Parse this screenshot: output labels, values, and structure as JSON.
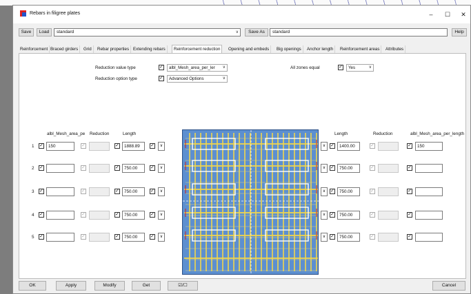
{
  "window": {
    "title": "Rebars in filigree plates",
    "minimize": "–",
    "maximize": "☐",
    "close": "✕"
  },
  "toolbar": {
    "save_label": "Save",
    "load_label": "Load",
    "preset_value": "standard",
    "saveas_label": "Save As",
    "saveas_value": "standard",
    "help_label": "Help"
  },
  "tabs": [
    "Reinforcement",
    "Braced girders",
    "Grid",
    "Rebar properties",
    "Extending rebars",
    "Reinforcement reduction",
    "Opening and embeds",
    "Big openings",
    "Anchor length",
    "Reinforcement areas",
    "Attributes"
  ],
  "active_tab": 5,
  "reduction": {
    "value_type_label": "Reduction value type",
    "value_type": "albl_Mesh_area_per_ler",
    "option_type_label": "Reduction option type",
    "option_type": "Advanced Options",
    "all_zones_label": "All zones equal",
    "all_zones_value": "Yes"
  },
  "left_headers": {
    "mesh": "albl_Mesh_area_pe",
    "reduction": "Reduction",
    "length": "Length"
  },
  "right_headers": {
    "length": "Length",
    "reduction": "Reduction",
    "mesh": "albl_Mesh_area_per_length"
  },
  "rows": [
    {
      "n": "1",
      "left_mesh": "150",
      "left_length": "1888.89",
      "right_length": "1400.00",
      "right_mesh": "150"
    },
    {
      "n": "2",
      "left_mesh": "",
      "left_length": "750.00",
      "right_length": "750.00",
      "right_mesh": ""
    },
    {
      "n": "3",
      "left_mesh": "",
      "left_length": "750.00",
      "right_length": "750.00",
      "right_mesh": ""
    },
    {
      "n": "4",
      "left_mesh": "",
      "left_length": "750.00",
      "right_length": "750.00",
      "right_mesh": ""
    },
    {
      "n": "5",
      "left_mesh": "",
      "left_length": "750.00",
      "right_length": "750.00",
      "right_mesh": ""
    }
  ],
  "bottom": {
    "ok": "OK",
    "apply": "Apply",
    "modify": "Modify",
    "get": "Get",
    "toggle": "☑/☐",
    "cancel": "Cancel"
  },
  "colors": {
    "plate": "#5c8fd0",
    "rebar": "#f2d64b",
    "marker": "#cc2222"
  }
}
